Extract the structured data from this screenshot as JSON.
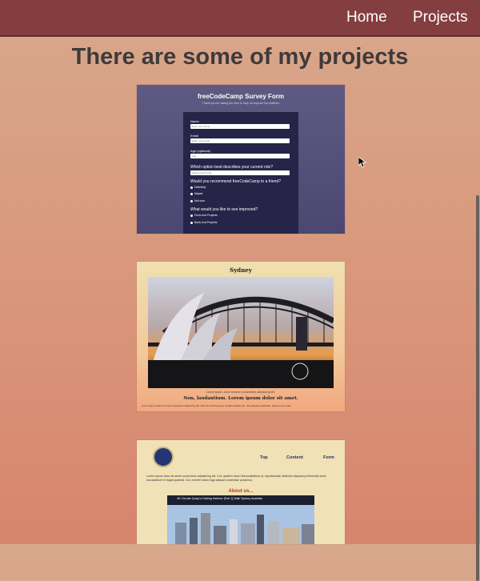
{
  "nav": {
    "home": "Home",
    "projects": "Projects"
  },
  "page": {
    "title": "There are some of my projects"
  },
  "projects": [
    {
      "title": "freeCodeCamp Survey Form",
      "subtitle": "Thank you for taking the time to help us improve the platform",
      "fields": [
        {
          "label": "Name",
          "placeholder": "Enter your name"
        },
        {
          "label": "Email",
          "placeholder": "Enter your email"
        },
        {
          "label": "Age (optional)",
          "placeholder": "Age"
        }
      ],
      "role_question": "Which option best describes your current role?",
      "role_select": "Select current role",
      "recommend_question": "Would you recommend freeCodeCamp to a friend?",
      "recommend_options": [
        "Definitely",
        "Maybe",
        "Not sure"
      ],
      "improve_question": "What would you like to see improved?",
      "improve_options": [
        "Front-end Projects",
        "Back-end Projects"
      ]
    },
    {
      "title": "Sydney",
      "caption": "Lorem ipsum, dolor sit amet consectetur adipisicing elit.",
      "heading": "Non, laudantium. Lorem ipsum dolor sit amet.",
      "body": "Lorem ipsum dolor sit amet consectetur adipisicing elit. Illum illo nihil fuga pos veritatis debitis iste, nihil aliquam explicabo, dolorum eos quas"
    },
    {
      "nav": [
        "Top",
        "Content",
        "Form"
      ],
      "text": "Lorem ipsum dolor sit amet consectetur adipisicing elit. Cut, quidem dolor! Necessitatibus et, repudiandae distinctio aliquam preferendis amet accusantium in fugiat quaerat. Cut, eveniet natus fuga aliquam molestiae possimus.",
      "about": "About us...",
      "video_title": "4K Circular Quay to Darling Harbour [Part 1] Walk Sydney Australia"
    }
  ]
}
